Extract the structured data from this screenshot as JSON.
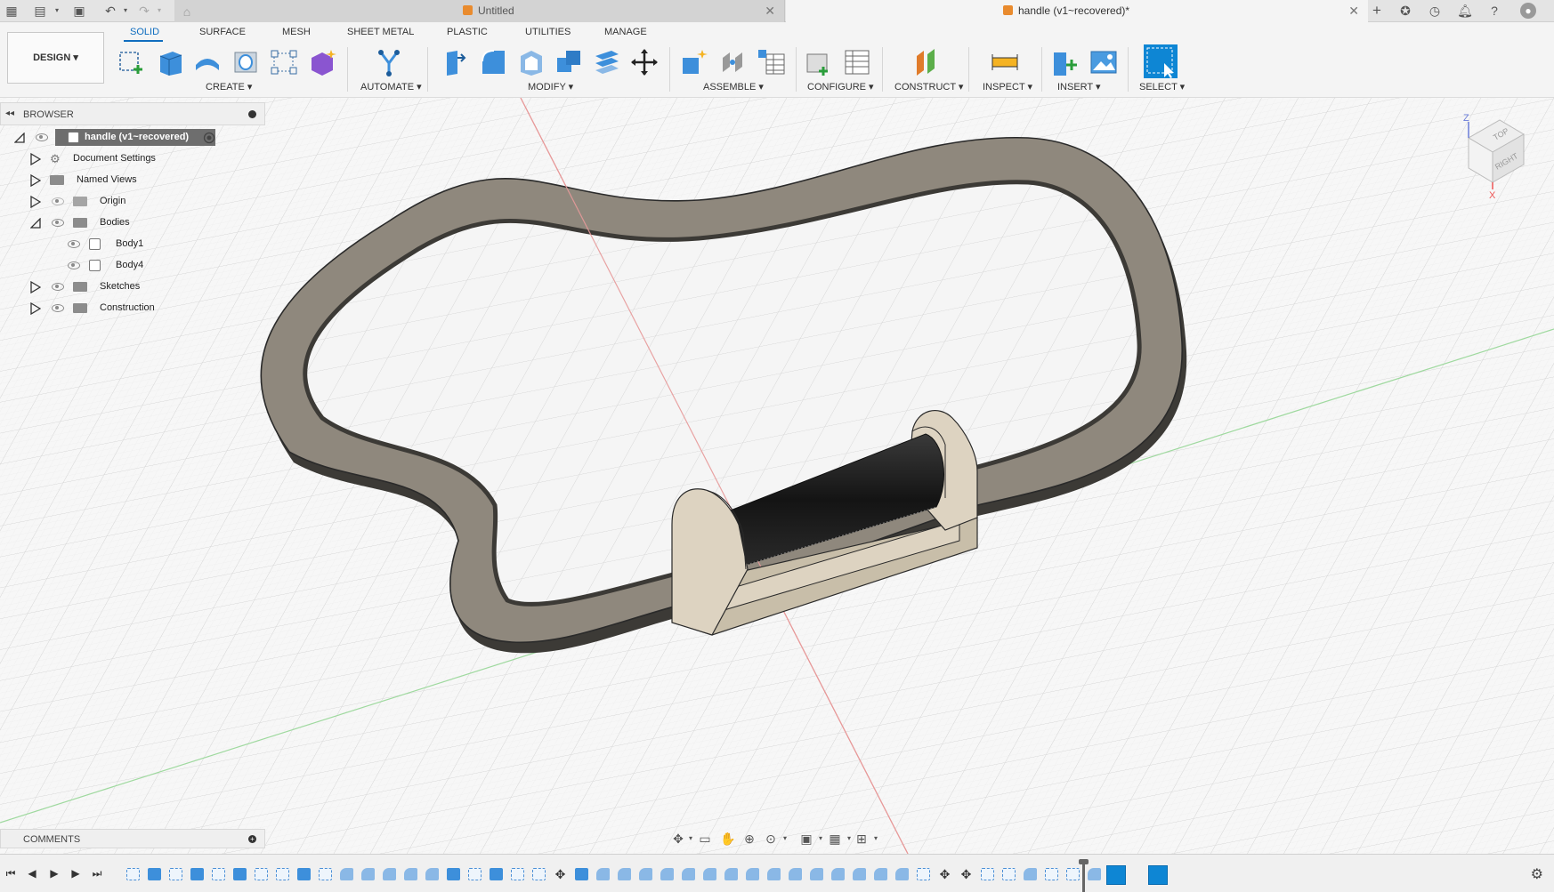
{
  "titlebar": {
    "tabs": [
      {
        "label": "Untitled",
        "active": false
      },
      {
        "label": "handle (v1~recovered)*",
        "active": true
      }
    ]
  },
  "toolbar": {
    "design_label": "DESIGN",
    "workspace_tabs": [
      "SOLID",
      "SURFACE",
      "MESH",
      "SHEET METAL",
      "PLASTIC",
      "UTILITIES",
      "MANAGE"
    ],
    "groups": [
      "CREATE",
      "AUTOMATE",
      "MODIFY",
      "ASSEMBLE",
      "CONFIGURE",
      "CONSTRUCT",
      "INSPECT",
      "INSERT",
      "SELECT"
    ]
  },
  "browser": {
    "header": "BROWSER",
    "root": "handle (v1~recovered)",
    "items": [
      {
        "label": "Document Settings"
      },
      {
        "label": "Named Views"
      },
      {
        "label": "Origin"
      },
      {
        "label": "Bodies"
      },
      {
        "label": "Body1"
      },
      {
        "label": "Body4"
      },
      {
        "label": "Sketches"
      },
      {
        "label": "Construction"
      }
    ]
  },
  "comments": {
    "header": "COMMENTS"
  },
  "viewcube": {
    "top": "TOP",
    "right": "RIGHT",
    "axis_z": "Z",
    "axis_x": "X"
  },
  "colors": {
    "accent": "#0f6dbf",
    "body_fill": "#908a80",
    "roller": "#1e1e1e",
    "bracket": "#ddd3c1"
  }
}
